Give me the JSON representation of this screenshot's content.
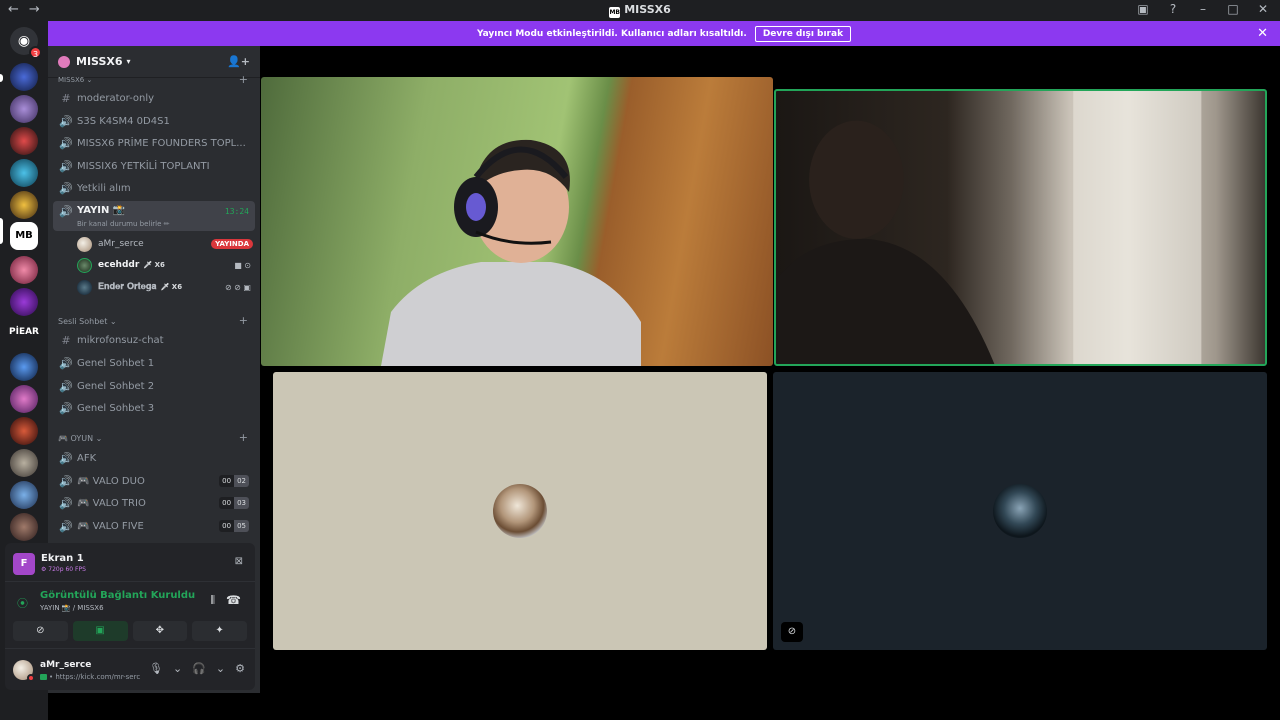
{
  "window": {
    "title": "MISSX6",
    "title_icon": "MB"
  },
  "notices": {
    "streamer_mode_text": "Yayıncı Modu etkinleştirildi. Kullanıcı adları kısaltıldı.",
    "disable_button": "Devre dışı bırak"
  },
  "guilds": {
    "home_badge": "3",
    "text_guild_label": "PİEAR"
  },
  "server": {
    "name": "MISSX6"
  },
  "categories": {
    "missx6": "MISSX6",
    "sesli_sohbet": "Sesli Sohbet",
    "oyun": "🎮 OYUN"
  },
  "channels": [
    {
      "name": "moderator-only",
      "type": "text"
    },
    {
      "name": "S3S K4SM4 0D4S1",
      "type": "voice"
    },
    {
      "name": "MISSX6 PRİME FOUNDERS TOPL...",
      "type": "voice"
    },
    {
      "name": "MISSIX6 YETKİLİ TOPLANTI",
      "type": "voice"
    },
    {
      "name": "Yetkili alım",
      "type": "voice"
    }
  ],
  "active_channel": {
    "name": "YAYIN 📸",
    "timer": "13:24",
    "status_prompt": "Bir kanal durumu belirle ✏"
  },
  "voice_users": [
    {
      "name": "aMr_serce",
      "badge": "YAYINDA"
    },
    {
      "name": "ecehddr",
      "tag": "🗡 X6"
    },
    {
      "name": "𝐄𝐧𝐝𝐞𝐫 𝐎𝐫𝐭𝐞𝐠𝐚",
      "tag": "🗡 X6"
    }
  ],
  "channels_sesli": [
    {
      "name": "mikrofonsuz-chat",
      "type": "text"
    },
    {
      "name": "Genel Sohbet 1",
      "type": "voice"
    },
    {
      "name": "Genel Sohbet 2",
      "type": "voice"
    },
    {
      "name": "Genel Sohbet 3",
      "type": "voice"
    }
  ],
  "channels_oyun": [
    {
      "name": "AFK",
      "type": "voice"
    },
    {
      "name": "🎮 VALO DUO",
      "type": "voice",
      "current": "00",
      "limit": "02"
    },
    {
      "name": "🎮 VALO TRIO",
      "type": "voice",
      "current": "00",
      "limit": "03"
    },
    {
      "name": "🎮 VALO FIVE",
      "type": "voice",
      "current": "00",
      "limit": "05"
    }
  ],
  "stream_panel": {
    "icon_letter": "F",
    "screen_name": "Ekran 1",
    "quality": "⚙ 720p 60 FPS",
    "connection_status": "Görüntülü Bağlantı Kuruldu",
    "connection_location": "YAYIN 📸 / MISSX6"
  },
  "user": {
    "name": "aMr_serce",
    "status": "• https://kick.com/mr-serce"
  },
  "colors": {
    "accent_purple": "#8c39f0",
    "speaking_green": "#23a559",
    "live_red": "#da373c"
  }
}
